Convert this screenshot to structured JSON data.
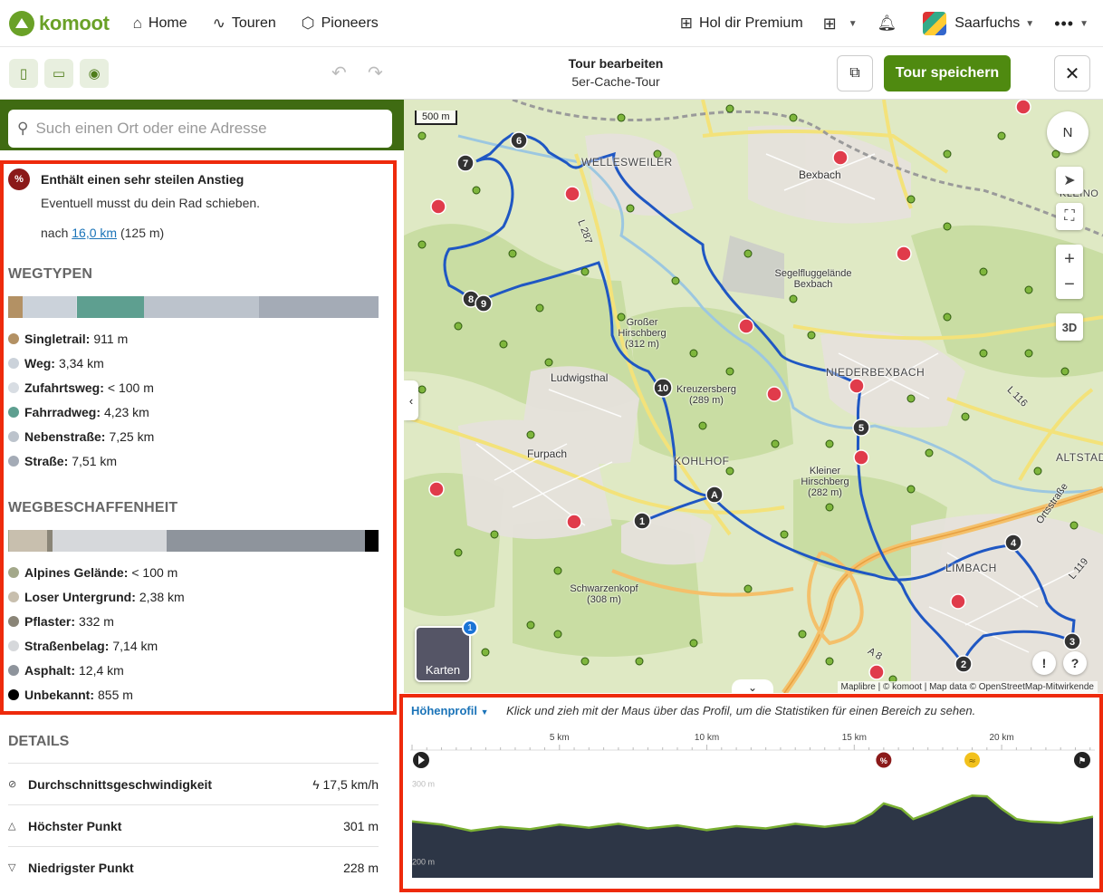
{
  "nav": {
    "logo": "komoot",
    "home": "Home",
    "touren": "Touren",
    "pioneers": "Pioneers",
    "premium": "Hol dir Premium",
    "user": "Saarfuchs"
  },
  "toolbar": {
    "title": "Tour bearbeiten",
    "subtitle": "5er-Cache-Tour",
    "save": "Tour speichern"
  },
  "search": {
    "placeholder": "Such einen Ort oder eine Adresse"
  },
  "warning": {
    "title": "Enthält einen sehr steilen Anstieg",
    "subtitle": "Eventuell musst du dein Rad schieben.",
    "after_prefix": "nach",
    "after_link": "16,0 km",
    "after_suffix": "(125 m)"
  },
  "wegtypen": {
    "heading": "WEGTYPEN",
    "items": [
      {
        "label": "Singletrail:",
        "value": "911 m",
        "color": "#b39164",
        "km": 0.911
      },
      {
        "label": "Weg:",
        "value": "3,34 km",
        "color": "#cbd2da",
        "km": 3.34
      },
      {
        "label": "Zufahrtsweg:",
        "value": "< 100 m",
        "color": "#d8dde3",
        "km": 0.05
      },
      {
        "label": "Fahrradweg:",
        "value": "4,23 km",
        "color": "#5e9f90",
        "km": 4.23
      },
      {
        "label": "Nebenstraße:",
        "value": "7,25 km",
        "color": "#bcc3cc",
        "km": 7.25
      },
      {
        "label": "Straße:",
        "value": "7,51 km",
        "color": "#a4abb6",
        "km": 7.51
      }
    ]
  },
  "wegbeschaffenheit": {
    "heading": "WEGBESCHAFFENHEIT",
    "items": [
      {
        "label": "Alpines Gelände:",
        "value": "< 100 m",
        "color": "#a3a88a",
        "km": 0.05
      },
      {
        "label": "Loser Untergrund:",
        "value": "2,38 km",
        "color": "#c8bfae",
        "km": 2.38
      },
      {
        "label": "Pflaster:",
        "value": "332 m",
        "color": "#8a8577",
        "km": 0.332
      },
      {
        "label": "Straßenbelag:",
        "value": "7,14 km",
        "color": "#d6d8db",
        "km": 7.14
      },
      {
        "label": "Asphalt:",
        "value": "12,4 km",
        "color": "#8e949c",
        "km": 12.4
      },
      {
        "label": "Unbekannt:",
        "value": "855 m",
        "color": "#000000",
        "km": 0.855
      }
    ]
  },
  "details": {
    "heading": "DETAILS",
    "rows": [
      {
        "label": "Durchschnittsgeschwindigkeit",
        "value": "17,5 km/h",
        "icon": "⊘",
        "valueicon": "ϟ"
      },
      {
        "label": "Höchster Punkt",
        "value": "301 m",
        "icon": "△",
        "valueicon": ""
      },
      {
        "label": "Niedrigster Punkt",
        "value": "228 m",
        "icon": "▽",
        "valueicon": ""
      }
    ]
  },
  "map": {
    "scale": "500 m",
    "compass": "N",
    "threed": "3D",
    "karten": "Karten",
    "karten_badge": "1",
    "attribution": "Maplibre | © komoot | Map data © OpenStreetMap-Mitwirkende",
    "labels": [
      "WELLESWEILER",
      "Bexbach",
      "Segelfluggelände Bexbach",
      "Großer Hirschberg (312 m)",
      "Ludwigsthal",
      "Kreuzersberg (289 m)",
      "NIEDERBEXBACH",
      "Furpach",
      "KOHLHOF",
      "Kleiner Hirschberg (282 m)",
      "ALTSTADT",
      "LIMBACH",
      "Schwarzenkopf (308 m)",
      "Ortsstraße",
      "L 287",
      "L 116",
      "L 119",
      "A 8",
      "KLEINO"
    ],
    "waypoints": [
      "1",
      "2",
      "3",
      "4",
      "5",
      "6",
      "7",
      "8",
      "9",
      "10",
      "A"
    ]
  },
  "elevation": {
    "selector": "Höhenprofil",
    "hint": "Klick und zieh mit der Maus über das Profil, um die Statistiken für einen Bereich zu sehen.",
    "ticks": [
      "5 km",
      "10 km",
      "15 km",
      "20 km"
    ],
    "y_labels": [
      "300 m",
      "200 m"
    ],
    "total_km": 23.1,
    "profile_km": [
      0,
      1,
      2,
      3,
      4,
      5,
      6,
      7,
      8,
      9,
      10,
      11,
      12,
      13,
      14,
      15,
      15.6,
      16,
      16.6,
      17,
      17.5,
      18,
      18.5,
      19,
      19.5,
      20,
      20.5,
      21,
      22,
      23.1
    ],
    "profile_m": [
      252,
      248,
      240,
      245,
      242,
      248,
      244,
      249,
      243,
      247,
      241,
      246,
      243,
      249,
      245,
      250,
      262,
      275,
      268,
      255,
      262,
      270,
      278,
      285,
      284,
      268,
      255,
      252,
      250,
      258
    ]
  }
}
